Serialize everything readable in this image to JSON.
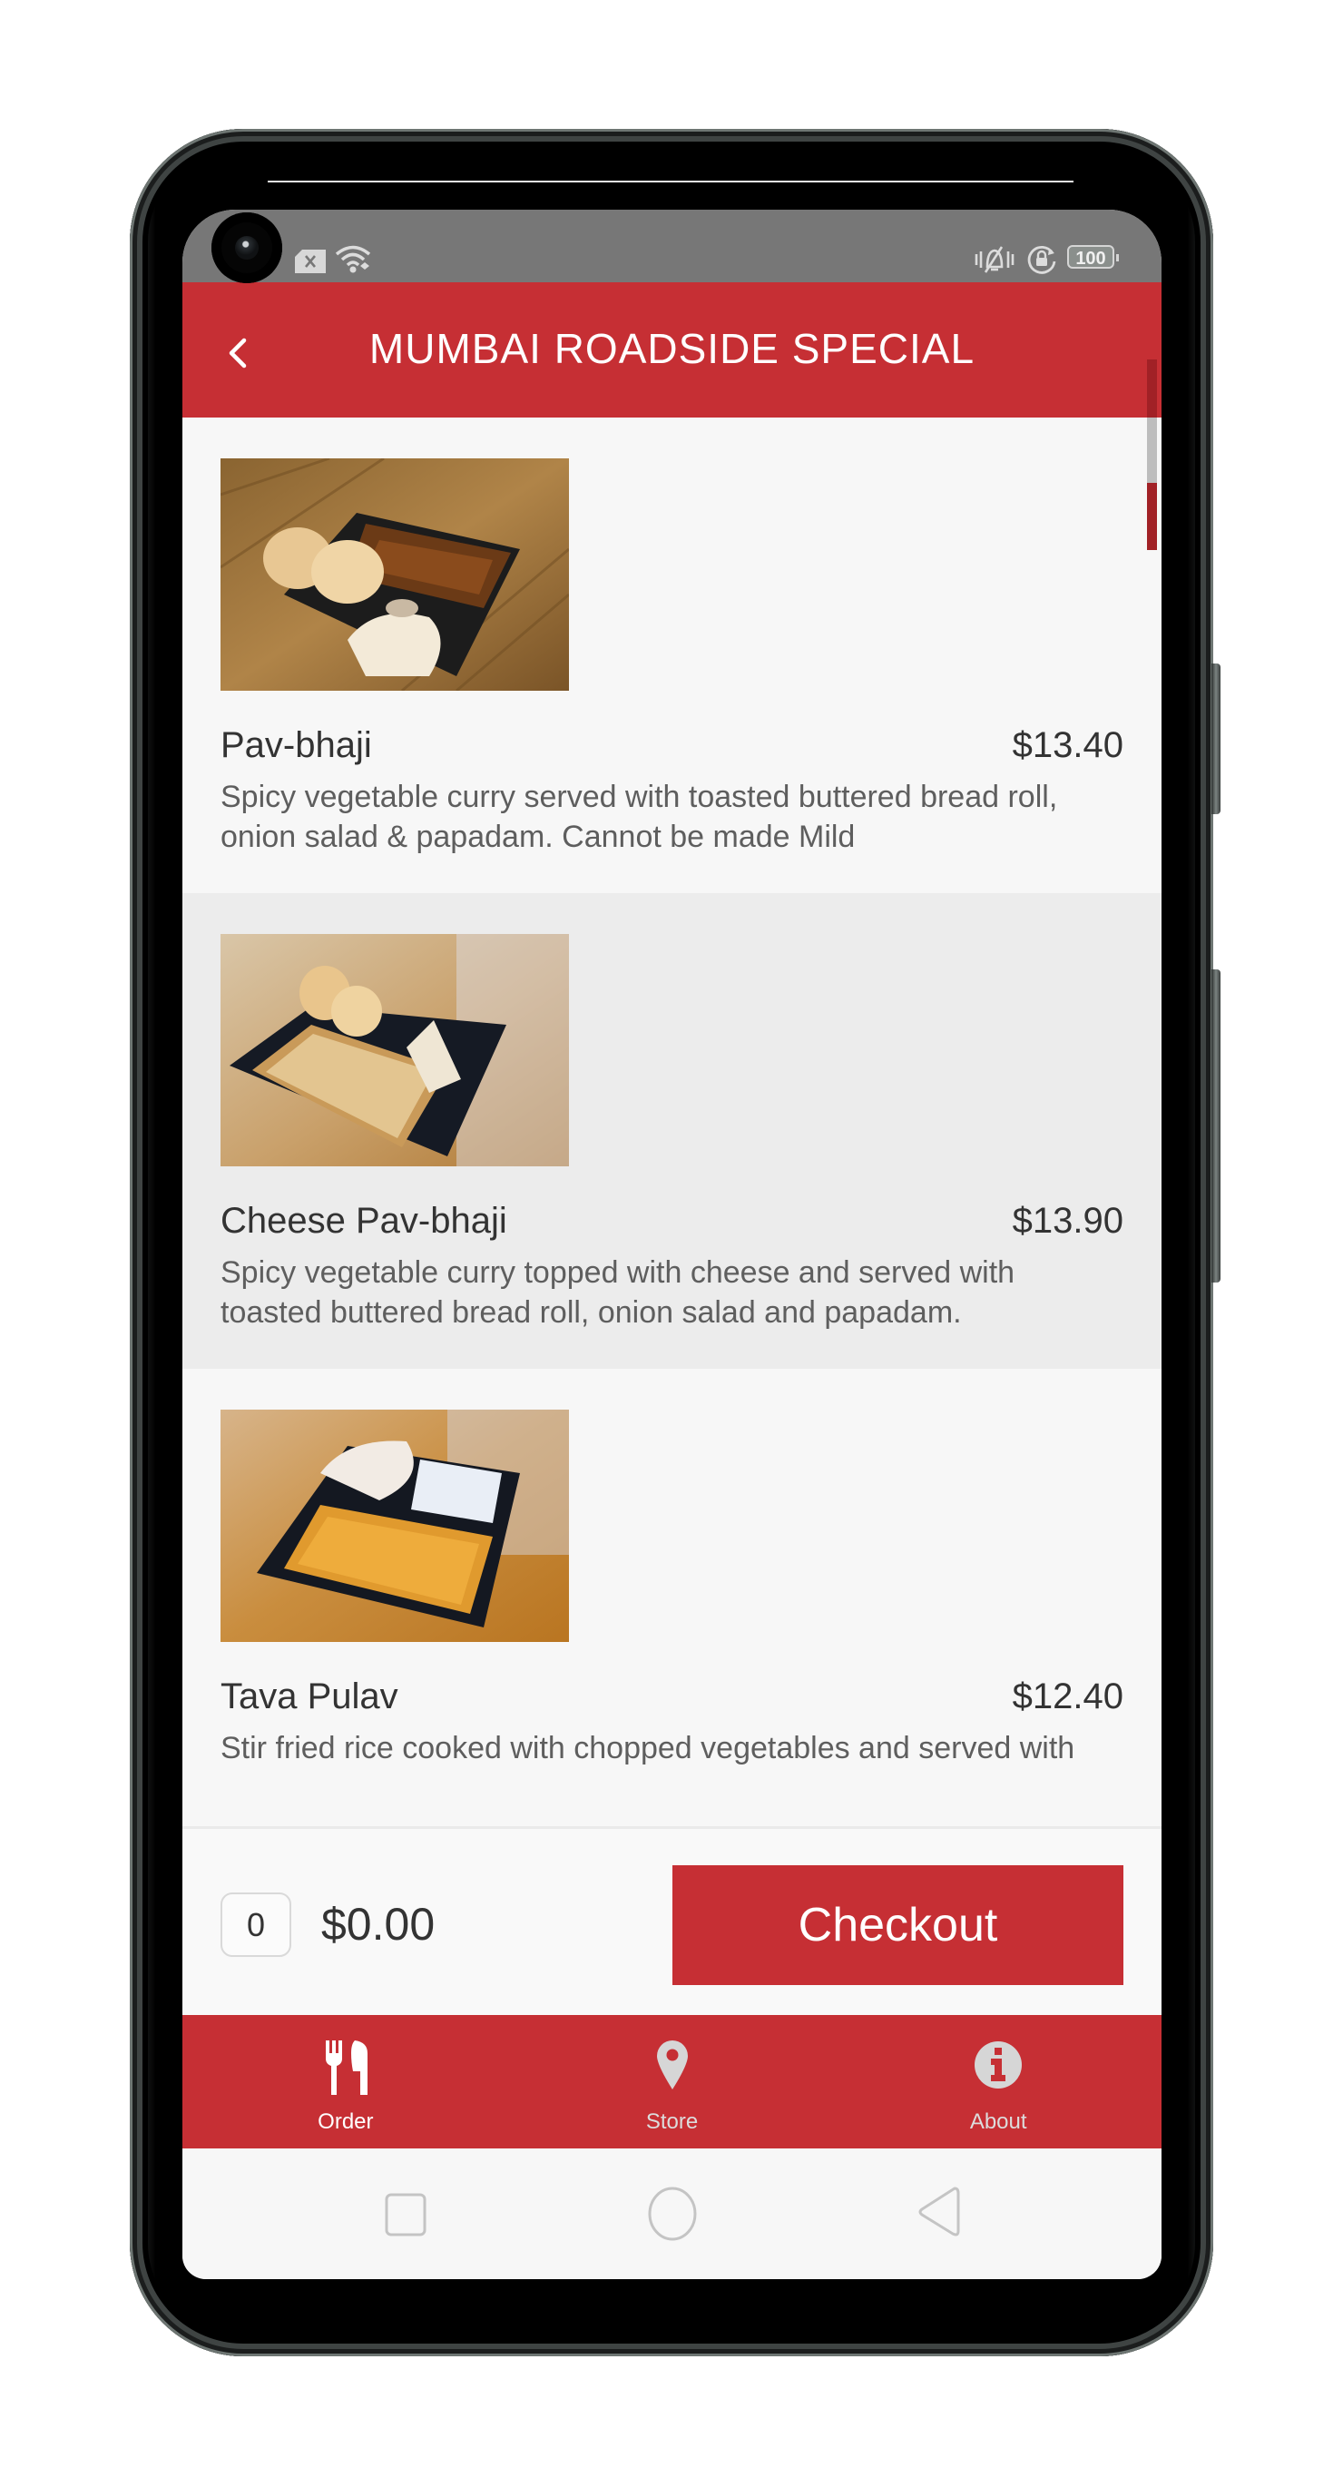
{
  "status_bar": {
    "left_icons": [
      "sim-card-error-icon",
      "wifi-icon"
    ],
    "right_icons": [
      "vibrate-off-icon",
      "rotation-lock-icon"
    ],
    "battery_level": "100"
  },
  "app_bar": {
    "back_icon": "chevron-left-icon",
    "title": "MUMBAI ROADSIDE SPECIAL"
  },
  "menu_items": [
    {
      "name": "Pav-bhaji",
      "price": "$13.40",
      "description": "Spicy vegetable curry served with toasted buttered bread roll, onion salad & papadam. Cannot be made Mild",
      "image_alt": "Pav-bhaji in black tray with buttered bread rolls and papadam"
    },
    {
      "name": "Cheese Pav-bhaji",
      "price": "$13.90",
      "description": "Spicy vegetable curry topped with cheese and served with toasted buttered bread roll, onion salad and papadam.",
      "image_alt": "Cheese Pav-bhaji in black tray with bread rolls and papadam"
    },
    {
      "name": "Tava Pulav",
      "price": "$12.40",
      "description": "Stir fried rice cooked with chopped vegetables and served with",
      "image_alt": "Tava Pulav rice in black tray with papadam and raita"
    }
  ],
  "cart": {
    "quantity": "0",
    "total": "$0.00",
    "checkout_label": "Checkout"
  },
  "tab_bar": {
    "tabs": [
      {
        "label": "Order",
        "icon": "utensils-icon",
        "active": true
      },
      {
        "label": "Store",
        "icon": "map-pin-icon",
        "active": false
      },
      {
        "label": "About",
        "icon": "info-icon",
        "active": false
      }
    ]
  },
  "system_nav": {
    "buttons": [
      "recents-button",
      "home-button",
      "back-button"
    ]
  },
  "colors": {
    "brand_red": "#c62f34",
    "status_bar_grey": "#777777",
    "list_bg": "#f7f7f7",
    "list_alt_bg": "#ececec"
  }
}
